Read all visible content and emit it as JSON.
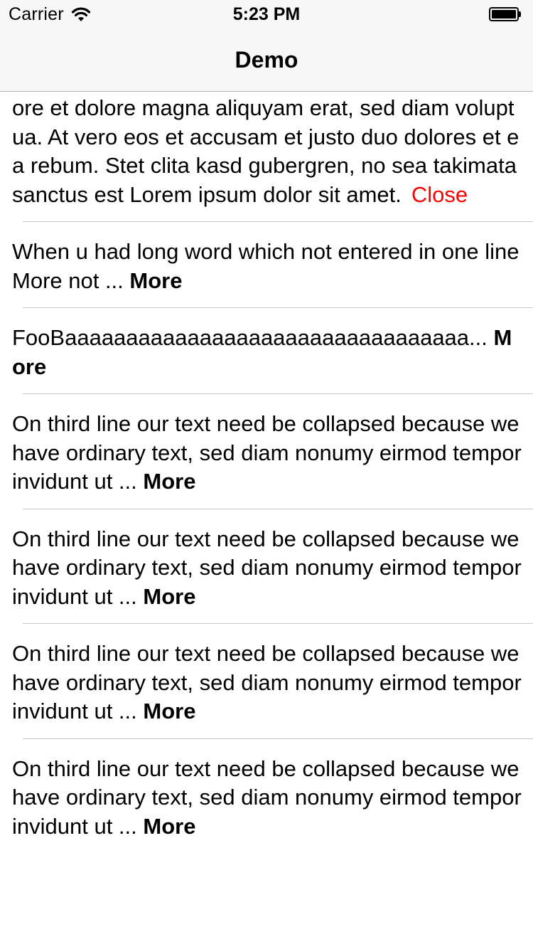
{
  "status_bar": {
    "carrier": "Carrier",
    "time": "5:23 PM",
    "wifi_icon": "wifi-icon",
    "battery_icon": "battery-icon"
  },
  "nav": {
    "title": "Demo"
  },
  "colors": {
    "close": "#ff0000",
    "more": "#000000",
    "separator": "#c8c7cc",
    "bar_background": "#f7f7f7"
  },
  "cells": [
    {
      "text": "Lorem ipsum dolor sit amet, consetetur sadipscing elitr, sed diam nonumy eirmod tempor invidunt ut labore et dolore magna aliquyam erat, sed diam voluptua. At vero eos et accusam et justo duo dolores et ea rebum. Stet clita kasd gubergren, no sea takimata sanctus est Lorem ipsum dolor sit amet.",
      "action": "Close"
    },
    {
      "text": "When u had long word which not entered in one line More not ...",
      "action": "More"
    },
    {
      "text": "FooBaaaaaaaaaaaaaaaaaaaaaaaaaaaaaaaaa...",
      "action": "More"
    },
    {
      "text": "On third line our text need be collapsed because we have ordinary text, sed diam nonumy eirmod tempor invidunt ut ...",
      "action": "More"
    },
    {
      "text": "On third line our text need be collapsed because we have ordinary text, sed diam nonumy eirmod tempor invidunt ut ...",
      "action": "More"
    },
    {
      "text": "On third line our text need be collapsed because we have ordinary text, sed diam nonumy eirmod tempor invidunt ut ...",
      "action": "More"
    },
    {
      "text": "On third line our text need be collapsed because we have ordinary text, sed diam nonumy eirmod tempor invidunt ut ...",
      "action": "More"
    }
  ]
}
